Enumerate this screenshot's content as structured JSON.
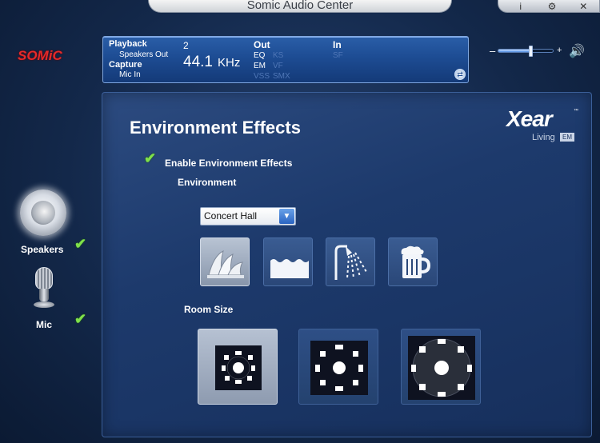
{
  "window": {
    "title": "Somic Audio Center",
    "controls": [
      "i",
      "⚙",
      "✕"
    ]
  },
  "logo": "SOMiC",
  "info": {
    "playback_label": "Playback",
    "playback_device": "Speakers Out",
    "capture_label": "Capture",
    "capture_device": "Mic In",
    "channels": "2",
    "rate": "44.1",
    "rate_unit": "KHz",
    "out_label": "Out",
    "in_label": "In",
    "out_items": [
      "EQ",
      "KS",
      "EM",
      "VF",
      "VSS",
      "SMX"
    ],
    "in_items": [
      "SF"
    ],
    "toggle_glyph": "⇄"
  },
  "volume": {
    "minus": "–",
    "plus": "+",
    "level": 0.6,
    "speaker_glyph": "🔊"
  },
  "sidebar": {
    "speakers_label": "Speakers",
    "mic_label": "Mic",
    "check_glyph": "✔"
  },
  "main": {
    "title": "Environment Effects",
    "brand": "Xear",
    "brand_tm": "™",
    "brand_living": "Living",
    "brand_em": "EM",
    "enable_label": "Enable Environment Effects",
    "environment_label": "Environment",
    "environment_selected": "Concert Hall",
    "environment_presets": [
      "concert-hall",
      "water",
      "shower",
      "pub"
    ],
    "selected_preset": 0,
    "room_size_label": "Room Size",
    "room_sizes": [
      "small",
      "medium",
      "large"
    ],
    "selected_room": 0
  },
  "colors": {
    "accent": "#2a64c2",
    "logo_red": "#e42a2a",
    "check_green": "#7fe04a",
    "panel_blue": "#1d4c93"
  }
}
